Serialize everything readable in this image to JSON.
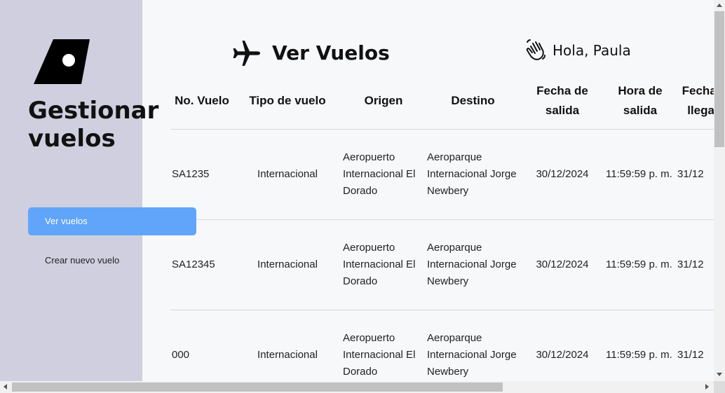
{
  "sidebar": {
    "title": "Gestionar vuelos",
    "nav": [
      {
        "label": "Ver vuelos",
        "active": true
      },
      {
        "label": "Crear nuevo vuelo",
        "active": false
      }
    ]
  },
  "header": {
    "title": "Ver Vuelos",
    "title_icon": "plane-icon",
    "greeting": "Hola, Paula",
    "greeting_icon": "waving-hand-icon"
  },
  "table": {
    "headers": [
      "No. Vuelo",
      "Tipo de vuelo",
      "Origen",
      "Destino",
      "Fecha de salida",
      "Hora de salida",
      "Fecha de llegada"
    ],
    "rows": [
      {
        "numero": "SA1235",
        "tipo": "Internacional",
        "origen": "Aeropuerto Internacional El Dorado",
        "destino": "Aeroparque Internacional Jorge Newbery",
        "fecha_salida": "30/12/2024",
        "hora_salida": "11:59:59 p. m.",
        "fecha_llegada": "31/12"
      },
      {
        "numero": "SA12345",
        "tipo": "Internacional",
        "origen": "Aeropuerto Internacional El Dorado",
        "destino": "Aeroparque Internacional Jorge Newbery",
        "fecha_salida": "30/12/2024",
        "hora_salida": "11:59:59 p. m.",
        "fecha_llegada": "31/12"
      },
      {
        "numero": "000",
        "tipo": "Internacional",
        "origen": "Aeropuerto Internacional El Dorado",
        "destino": "Aeroparque Internacional Jorge Newbery",
        "fecha_salida": "30/12/2024",
        "hora_salida": "11:59:59 p. m.",
        "fecha_llegada": "31/12"
      }
    ]
  },
  "colors": {
    "sidebar_bg": "#cfcfdf",
    "accent": "#60a5fa",
    "main_bg": "#f7f8fa"
  }
}
